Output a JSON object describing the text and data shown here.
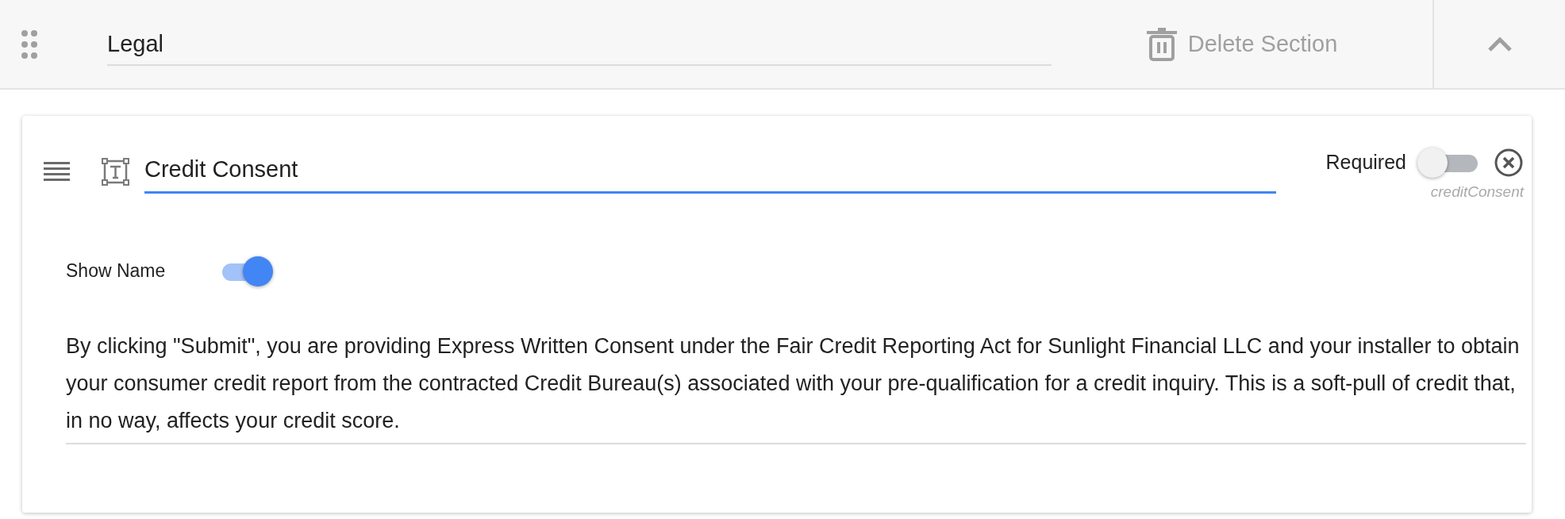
{
  "section": {
    "title": "Legal",
    "delete_label": "Delete Section",
    "expanded": true
  },
  "field": {
    "title": "Credit Consent",
    "required_label": "Required",
    "required": false,
    "key": "creditConsent",
    "show_name_label": "Show Name",
    "show_name": true,
    "text": "By clicking \"Submit\", you are providing Express Written Consent under the Fair Credit Reporting Act for Sunlight Financial LLC and your installer to obtain your consumer credit report from the contracted Credit Bureau(s) associated with your pre-qualification for a credit inquiry. This is a soft-pull of credit that, in no way, affects your credit score."
  }
}
